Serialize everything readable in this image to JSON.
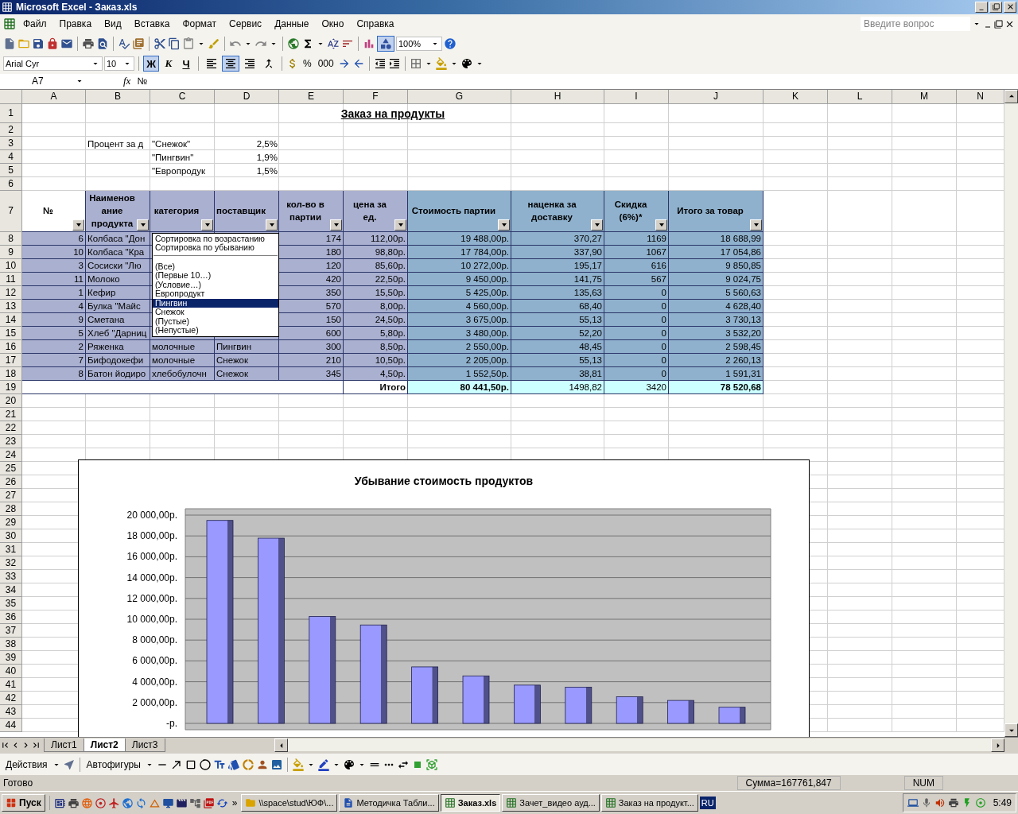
{
  "window": {
    "title": "Microsoft Excel - Заказ.xls"
  },
  "menu": [
    "Файл",
    "Правка",
    "Вид",
    "Вставка",
    "Формат",
    "Сервис",
    "Данные",
    "Окно",
    "Справка"
  ],
  "help": {
    "placeholder": "Введите вопрос"
  },
  "standard_toolbar": {
    "zoom": "100%"
  },
  "formatting_toolbar": {
    "font": "Arial Cyr",
    "size": "10",
    "styles": [
      {
        "label": "Ж",
        "pressed": true
      },
      {
        "label": "К",
        "pressed": false
      },
      {
        "label": "Ч",
        "pressed": false
      }
    ],
    "alignment": [
      {
        "kind": "left",
        "pressed": false
      },
      {
        "kind": "center",
        "pressed": true
      },
      {
        "kind": "right",
        "pressed": false
      },
      {
        "kind": "merge",
        "pressed": false
      }
    ],
    "percent": "%",
    "thousands": "000"
  },
  "formula_bar": {
    "name_box": "A7",
    "fx": "fx",
    "content": "№"
  },
  "columns": [
    "A",
    "B",
    "C",
    "D",
    "E",
    "F",
    "G",
    "H",
    "I",
    "J",
    "K",
    "L",
    "M",
    "N"
  ],
  "row_numbers": [
    "1",
    "2",
    "3",
    "4",
    "5",
    "6",
    "7",
    "8",
    "9",
    "10",
    "11",
    "12",
    "13",
    "14",
    "15",
    "16",
    "17",
    "18",
    "19",
    "20",
    "21",
    "22",
    "23",
    "24",
    "25",
    "26",
    "27",
    "28",
    "29",
    "30",
    "31",
    "32",
    "33",
    "34",
    "35",
    "36",
    "37",
    "38",
    "39",
    "40",
    "41",
    "42",
    "43",
    "44"
  ],
  "title": "Заказ на продукты",
  "rates": [
    {
      "label": "Процент за д",
      "supplier": "\"Снежок\"",
      "value": "2,5%"
    },
    {
      "supplier": "\"Пингвин\"",
      "value": "1,9%"
    },
    {
      "supplier": "\"Европродук",
      "value": "1,5%"
    }
  ],
  "table": {
    "columns": [
      "№",
      "Наименование продукта",
      "категория",
      "поставщик",
      "кол-во в партии",
      "цена за ед.",
      "Стоимость партии",
      "наценка за доставку",
      "Скидка (6%)*",
      "Итого за товар"
    ],
    "rows": [
      {
        "no": "6",
        "name": "Колбаса \"Дон",
        "qty": "174",
        "price": "112,00р.",
        "cost": "19 488,00р.",
        "markup": "370,27",
        "discount": "1169",
        "total": "18 688,99"
      },
      {
        "no": "10",
        "name": "Колбаса \"Кра",
        "qty": "180",
        "price": "98,80р.",
        "cost": "17 784,00р.",
        "markup": "337,90",
        "discount": "1067",
        "total": "17 054,86"
      },
      {
        "no": "3",
        "name": "Сосиски \"Лю",
        "qty": "120",
        "price": "85,60р.",
        "cost": "10 272,00р.",
        "markup": "195,17",
        "discount": "616",
        "total": "9 850,85"
      },
      {
        "no": "11",
        "name": "Молоко",
        "qty": "420",
        "price": "22,50р.",
        "cost": "9 450,00р.",
        "markup": "141,75",
        "discount": "567",
        "total": "9 024,75"
      },
      {
        "no": "1",
        "name": "Кефир",
        "qty": "350",
        "price": "15,50р.",
        "cost": "5 425,00р.",
        "markup": "135,63",
        "discount": "0",
        "total": "5 560,63"
      },
      {
        "no": "4",
        "name": "Булка \"Майс",
        "qty": "570",
        "price": "8,00р.",
        "cost": "4 560,00р.",
        "markup": "68,40",
        "discount": "0",
        "total": "4 628,40"
      },
      {
        "no": "9",
        "name": "Сметана",
        "qty": "150",
        "price": "24,50р.",
        "cost": "3 675,00р.",
        "markup": "55,13",
        "discount": "0",
        "total": "3 730,13"
      },
      {
        "no": "5",
        "name": "Хлеб \"Дарниц",
        "qty": "600",
        "price": "5,80р.",
        "cost": "3 480,00р.",
        "markup": "52,20",
        "discount": "0",
        "total": "3 532,20"
      },
      {
        "no": "2",
        "name": "Ряженка",
        "category": "молочные",
        "supplier": "Пингвин",
        "qty": "300",
        "price": "8,50р.",
        "cost": "2 550,00р.",
        "markup": "48,45",
        "discount": "0",
        "total": "2 598,45"
      },
      {
        "no": "7",
        "name": "Бифодокефи",
        "category": "молочные",
        "supplier": "Снежок",
        "qty": "210",
        "price": "10,50р.",
        "cost": "2 205,00р.",
        "markup": "55,13",
        "discount": "0",
        "total": "2 260,13"
      },
      {
        "no": "8",
        "name": "Батон йодиро",
        "category": "хлебобулочн",
        "supplier": "Снежок",
        "qty": "345",
        "price": "4,50р.",
        "cost": "1 552,50р.",
        "markup": "38,81",
        "discount": "0",
        "total": "1 591,31"
      }
    ],
    "totals": {
      "label": "Итого",
      "values": [
        "80 441,50р.",
        "1498,82",
        "3420",
        "78 520,68"
      ]
    }
  },
  "filter_menu": {
    "sort": [
      "Сортировка по возрастанию",
      "Сортировка по убыванию"
    ],
    "items": [
      {
        "label": "(Все)",
        "selected": false
      },
      {
        "label": "(Первые 10…)",
        "selected": false
      },
      {
        "label": "(Условие…)",
        "selected": false
      },
      {
        "label": "Европродукт",
        "selected": false
      },
      {
        "label": "Пингвин",
        "selected": true
      },
      {
        "label": "Снежок",
        "selected": false
      },
      {
        "label": "(Пустые)",
        "selected": false
      },
      {
        "label": "(Непустые)",
        "selected": false
      }
    ]
  },
  "chart": {
    "title": "Убывание стоимость продуктов",
    "chart_data": {
      "type": "bar",
      "grid": true,
      "values": [
        19488,
        17784,
        10272,
        9450,
        5425,
        4560,
        3675,
        3480,
        2550,
        2205,
        1552.5
      ],
      "ylim": [
        0,
        20000
      ],
      "yticks": [
        {
          "value": 0,
          "label": "-р."
        },
        {
          "value": 2000,
          "label": "2 000,00р."
        },
        {
          "value": 4000,
          "label": "4 000,00р."
        },
        {
          "value": 6000,
          "label": "6 000,00р."
        },
        {
          "value": 8000,
          "label": "8 000,00р."
        },
        {
          "value": 10000,
          "label": "10 000,00р."
        },
        {
          "value": 12000,
          "label": "12 000,00р."
        },
        {
          "value": 14000,
          "label": "14 000,00р."
        },
        {
          "value": 16000,
          "label": "16 000,00р."
        },
        {
          "value": 18000,
          "label": "18 000,00р."
        },
        {
          "value": 20000,
          "label": "20 000,00р."
        }
      ]
    }
  },
  "sheet_tabs": [
    {
      "label": "Лист1",
      "selected": false
    },
    {
      "label": "Лист2",
      "selected": true
    },
    {
      "label": "Лист3",
      "selected": false
    }
  ],
  "drawing_toolbar": {
    "actions": "Действия",
    "autoshapes": "Автофигуры"
  },
  "status_bar": {
    "text": "Готово",
    "sum": "Сумма=167761,847",
    "num": "NUM"
  },
  "taskbar": {
    "start": "Пуск",
    "more": "»",
    "tasks": [
      {
        "label": "\\\\space\\stud\\ЮФ\\...",
        "kind": "folder",
        "selected": false
      },
      {
        "label": "Методичка Табли...",
        "kind": "word",
        "selected": false
      },
      {
        "label": "Заказ.xls",
        "kind": "excel",
        "selected": true
      },
      {
        "label": "Зачет_видео ауд...",
        "kind": "excel",
        "selected": false
      },
      {
        "label": "Заказ на продукт...",
        "kind": "excel",
        "selected": false
      }
    ],
    "language": "RU",
    "clock": "5:49"
  }
}
